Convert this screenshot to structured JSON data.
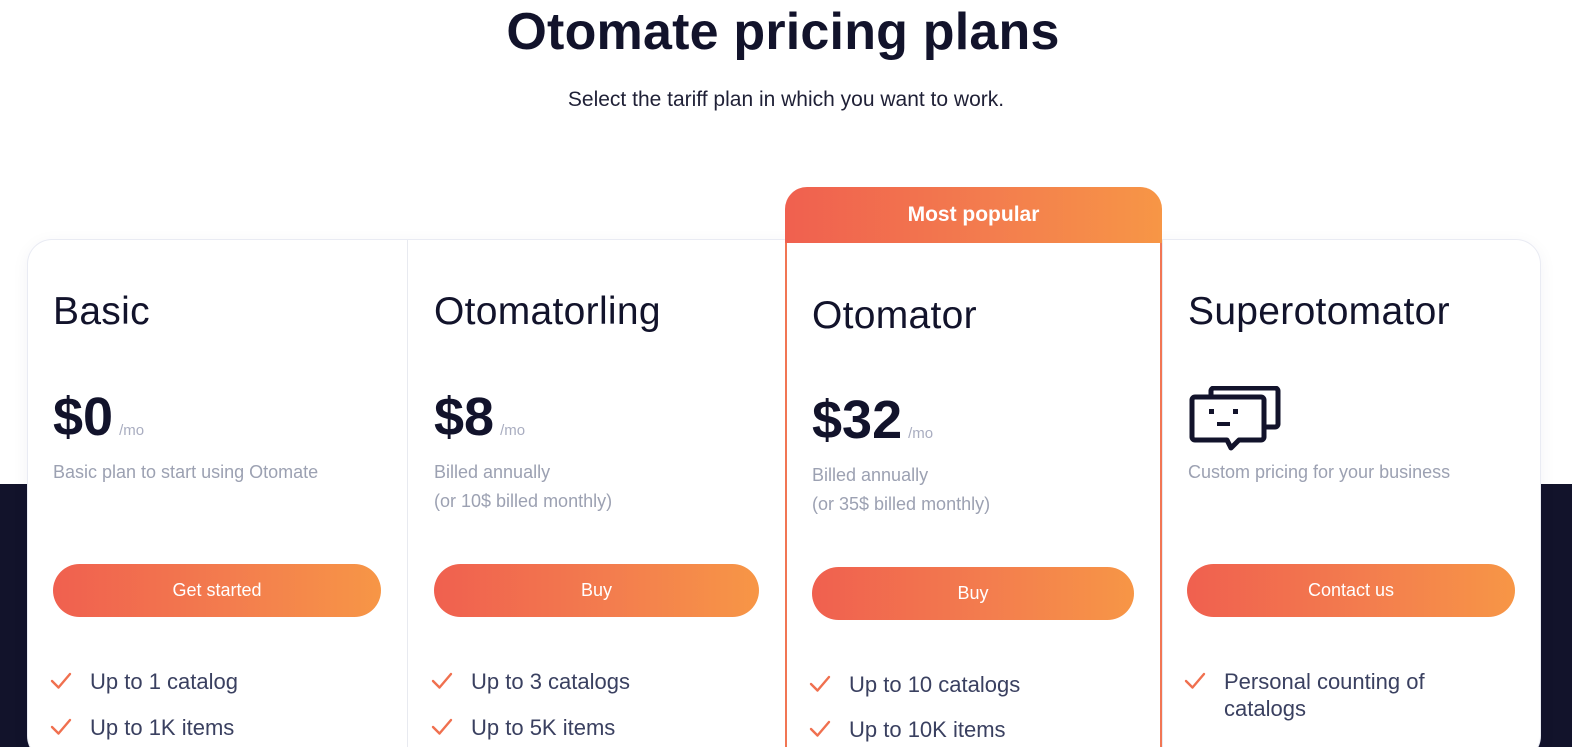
{
  "header": {
    "title": "Otomate pricing plans",
    "subtitle": "Select the tariff plan in which you want to work."
  },
  "colors": {
    "accent_start": "#f0604f",
    "accent_end": "#f79646",
    "dark_navy": "#12132b",
    "muted_text": "#9ca1b2"
  },
  "plans": [
    {
      "name": "Basic",
      "price": "$0",
      "period": "/mo",
      "note_lines": [
        "Basic plan to start using Otomate"
      ],
      "button_label": "Get started",
      "features": [
        "Up to 1 catalog",
        "Up to 1K items"
      ]
    },
    {
      "name": "Otomatorling",
      "price": "$8",
      "period": "/mo",
      "note_lines": [
        "Billed annually",
        "(or 10$ billed monthly)"
      ],
      "button_label": "Buy",
      "features": [
        "Up to 3 catalogs",
        "Up to 5K items"
      ]
    },
    {
      "name": "Otomator",
      "badge": "Most popular",
      "price": "$32",
      "period": "/mo",
      "note_lines": [
        "Billed annually",
        "(or 35$ billed monthly)"
      ],
      "button_label": "Buy",
      "features": [
        "Up to 10 catalogs",
        "Up to 10K items"
      ]
    },
    {
      "name": "Superotomator",
      "icon": "chat-bubbles-icon",
      "note_lines": [
        "Custom pricing for your business"
      ],
      "button_label": "Contact us",
      "features": [
        "Personal counting of catalogs"
      ]
    }
  ]
}
